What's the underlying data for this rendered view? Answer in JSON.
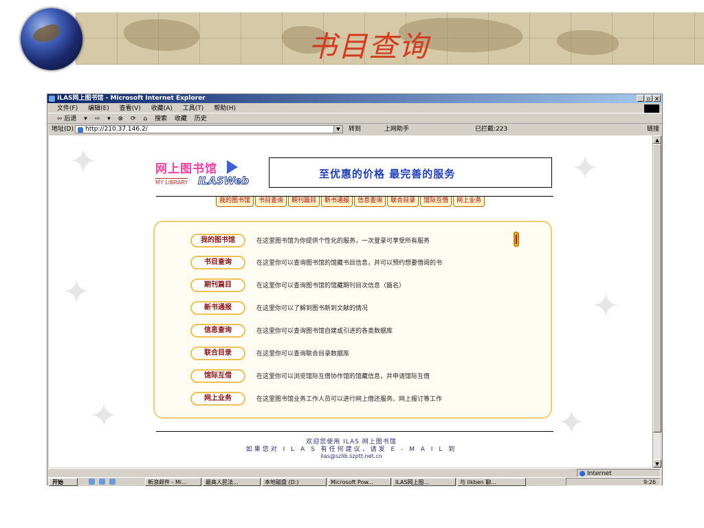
{
  "slide": {
    "title": "书目查询"
  },
  "window": {
    "title": "ILAS网上图书馆 - Microsoft Internet Explorer",
    "buttons": [
      "_",
      "▫",
      "×"
    ],
    "menu": [
      "文件(F)",
      "编辑(E)",
      "查看(V)",
      "收藏(A)",
      "工具(T)",
      "帮助(H)"
    ],
    "toolbar": [
      "⇦ 后退",
      "▾",
      "⇨",
      "▾",
      "⊗",
      "⟳",
      "⌂",
      "搜索",
      "收藏",
      "历史"
    ],
    "address_label": "地址(D)",
    "address_value": "http://210.37.146.2/",
    "go_label": "转到",
    "helper_label": "上网助手",
    "blocked_label": "已拦截:223",
    "links_label": "链接"
  },
  "page": {
    "logo_cn": "网上图书馆",
    "logo_my_library": "MY LIBRARY",
    "logo_ilas": "ILASWeb",
    "slogan": "至优惠的价格 最完善的服务",
    "nav": [
      "我的图书馆",
      "书目查询",
      "期刊篇目",
      "新书通报",
      "信息查询",
      "联合目录",
      "馆际互借",
      "网上业务"
    ],
    "services": [
      {
        "name": "我的图书馆",
        "desc": "在这里图书馆为你提供个性化的服务，一次登录可享受所有服务"
      },
      {
        "name": "书目查询",
        "desc": "在这里你可以查询图书馆的馆藏书目信息，并可以预约想要借阅的书"
      },
      {
        "name": "期刊篇目",
        "desc": "在这里你可以查询图书馆的馆藏期刊目次信息（篇名）"
      },
      {
        "name": "新书通报",
        "desc": "在这里你可以了解到图书新到文献的情况"
      },
      {
        "name": "信息查询",
        "desc": "在这里你可以查询图书馆自建或引进的各类数据库"
      },
      {
        "name": "联合目录",
        "desc": "在这里你可以查询联合目录数据库"
      },
      {
        "name": "馆际互借",
        "desc": "在这里你可以浏览馆际互借协作馆的馆藏信息，并申请馆际互借"
      },
      {
        "name": "网上业务",
        "desc": "在这里图书馆业务工作人员可以进行网上借还服务、网上报订等工作"
      }
    ],
    "footer_line1": "欢迎您使用 ILAS 网上图书馆",
    "footer_line2": "如果您对 I L A S 有任何建议，请发 E - M A I L 到",
    "footer_email": "ilas@szlib.szptt.net.cn"
  },
  "status": {
    "zone": "Internet"
  },
  "taskbar": {
    "start": "开始",
    "tasks": [
      "新浪邮件 - Mi...",
      "最高人民法...",
      "本地磁盘 (D:)",
      "Microsoft Pow...",
      "ILAS网上图...",
      "与 likben 聊..."
    ],
    "clock": "9:26"
  }
}
